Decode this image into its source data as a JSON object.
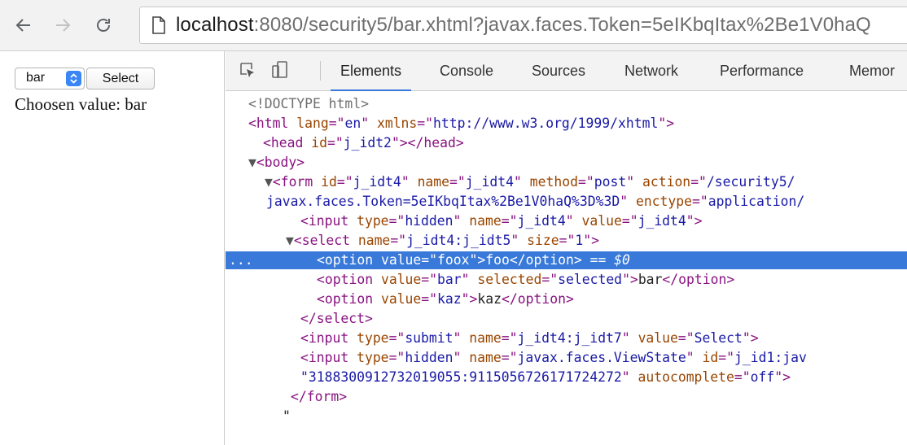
{
  "browser": {
    "url_host": "localhost",
    "url_rest": ":8080/security5/bar.xhtml?javax.faces.Token=5eIKbqItax%2Be1V0haQ"
  },
  "page": {
    "select_value": "bar",
    "submit_label": "Select",
    "chosen_text": "Choosen value: bar"
  },
  "devtools": {
    "tabs": [
      "Elements",
      "Console",
      "Sources",
      "Network",
      "Performance",
      "Memor"
    ],
    "active_tab": "Elements",
    "selected_line_index": 6,
    "lines": [
      [
        [
          "cm",
          "<!DOCTYPE html>"
        ]
      ],
      [
        [
          "tg",
          "<html "
        ],
        [
          "an",
          "lang"
        ],
        [
          "tg",
          "=\""
        ],
        [
          "av",
          "en"
        ],
        [
          "tg",
          "\" "
        ],
        [
          "an",
          "xmlns"
        ],
        [
          "tg",
          "=\""
        ],
        [
          "av",
          "http://www.w3.org/1999/xhtml"
        ],
        [
          "tg",
          "\">"
        ]
      ],
      [
        [
          "tg",
          "<head "
        ],
        [
          "an",
          "id"
        ],
        [
          "tg",
          "=\""
        ],
        [
          "av",
          "j_idt2"
        ],
        [
          "tg",
          "\"></head>"
        ]
      ],
      [
        [
          "tri",
          "▼"
        ],
        [
          "tg",
          "<body>"
        ]
      ],
      [
        [
          "tri",
          "▼"
        ],
        [
          "tg",
          "<form "
        ],
        [
          "an",
          "id"
        ],
        [
          "tg",
          "=\""
        ],
        [
          "av",
          "j_idt4"
        ],
        [
          "tg",
          "\" "
        ],
        [
          "an",
          "name"
        ],
        [
          "tg",
          "=\""
        ],
        [
          "av",
          "j_idt4"
        ],
        [
          "tg",
          "\" "
        ],
        [
          "an",
          "method"
        ],
        [
          "tg",
          "=\""
        ],
        [
          "av",
          "post"
        ],
        [
          "tg",
          "\" "
        ],
        [
          "an",
          "action"
        ],
        [
          "tg",
          "=\""
        ],
        [
          "av",
          "/security5/"
        ]
      ],
      [
        [
          "av",
          "javax.faces.Token=5eIKbqItax%2Be1V0haQ%3D%3D"
        ],
        [
          "tg",
          "\" "
        ],
        [
          "an",
          "enctype"
        ],
        [
          "tg",
          "=\""
        ],
        [
          "av",
          "application/"
        ]
      ],
      [
        [
          "tg",
          "<input "
        ],
        [
          "an",
          "type"
        ],
        [
          "tg",
          "=\""
        ],
        [
          "av",
          "hidden"
        ],
        [
          "tg",
          "\" "
        ],
        [
          "an",
          "name"
        ],
        [
          "tg",
          "=\""
        ],
        [
          "av",
          "j_idt4"
        ],
        [
          "tg",
          "\" "
        ],
        [
          "an",
          "value"
        ],
        [
          "tg",
          "=\""
        ],
        [
          "av",
          "j_idt4"
        ],
        [
          "tg",
          "\">"
        ]
      ],
      [
        [
          "tri",
          "▼"
        ],
        [
          "tg",
          "<select "
        ],
        [
          "an",
          "name"
        ],
        [
          "tg",
          "=\""
        ],
        [
          "av",
          "j_idt4:j_idt5"
        ],
        [
          "tg",
          "\" "
        ],
        [
          "an",
          "size"
        ],
        [
          "tg",
          "=\""
        ],
        [
          "av",
          "1"
        ],
        [
          "tg",
          "\">"
        ]
      ],
      [
        [
          "tg",
          "<option "
        ],
        [
          "an",
          "value"
        ],
        [
          "tg",
          "=\""
        ],
        [
          "av",
          "foox"
        ],
        [
          "tg",
          "\">"
        ],
        [
          "tx",
          "foo"
        ],
        [
          "tg",
          "</option>"
        ],
        [
          "tx",
          " == $0"
        ]
      ],
      [
        [
          "tg",
          "<option "
        ],
        [
          "an",
          "value"
        ],
        [
          "tg",
          "=\""
        ],
        [
          "av",
          "bar"
        ],
        [
          "tg",
          "\" "
        ],
        [
          "an",
          "selected"
        ],
        [
          "tg",
          "=\""
        ],
        [
          "av",
          "selected"
        ],
        [
          "tg",
          "\">"
        ],
        [
          "tx",
          "bar"
        ],
        [
          "tg",
          "</option>"
        ]
      ],
      [
        [
          "tg",
          "<option "
        ],
        [
          "an",
          "value"
        ],
        [
          "tg",
          "=\""
        ],
        [
          "av",
          "kaz"
        ],
        [
          "tg",
          "\">"
        ],
        [
          "tx",
          "kaz"
        ],
        [
          "tg",
          "</option>"
        ]
      ],
      [
        [
          "tg",
          "</select>"
        ]
      ],
      [
        [
          "tg",
          "<input "
        ],
        [
          "an",
          "type"
        ],
        [
          "tg",
          "=\""
        ],
        [
          "av",
          "submit"
        ],
        [
          "tg",
          "\" "
        ],
        [
          "an",
          "name"
        ],
        [
          "tg",
          "=\""
        ],
        [
          "av",
          "j_idt4:j_idt7"
        ],
        [
          "tg",
          "\" "
        ],
        [
          "an",
          "value"
        ],
        [
          "tg",
          "=\""
        ],
        [
          "av",
          "Select"
        ],
        [
          "tg",
          "\">"
        ]
      ],
      [
        [
          "tg",
          "<input "
        ],
        [
          "an",
          "type"
        ],
        [
          "tg",
          "=\""
        ],
        [
          "av",
          "hidden"
        ],
        [
          "tg",
          "\" "
        ],
        [
          "an",
          "name"
        ],
        [
          "tg",
          "=\""
        ],
        [
          "av",
          "javax.faces.ViewState"
        ],
        [
          "tg",
          "\" "
        ],
        [
          "an",
          "id"
        ],
        [
          "tg",
          "=\""
        ],
        [
          "av",
          "j_id1:jav"
        ]
      ],
      [
        [
          "av",
          "\"3188300912732019055:9115056726171724272"
        ],
        [
          "tg",
          "\" "
        ],
        [
          "an",
          "autocomplete"
        ],
        [
          "tg",
          "=\""
        ],
        [
          "av",
          "off"
        ],
        [
          "tg",
          "\">"
        ]
      ],
      [
        [
          "tg",
          "</form>"
        ]
      ],
      [
        [
          "tx",
          "\""
        ]
      ]
    ],
    "selected_marker": "..."
  },
  "icons": {
    "back": "arrow-left-icon",
    "forward": "arrow-right-icon",
    "reload": "reload-icon",
    "page": "page-icon",
    "inspect": "inspect-element-icon",
    "device": "device-toolbar-icon",
    "select_arrow": "chevron-updown-icon"
  },
  "colors": {
    "selection": "#3879d9",
    "tag": "#881280",
    "attr_name": "#994500",
    "attr_value": "#1a1aa6",
    "select_arrow": "#3b86f5"
  }
}
